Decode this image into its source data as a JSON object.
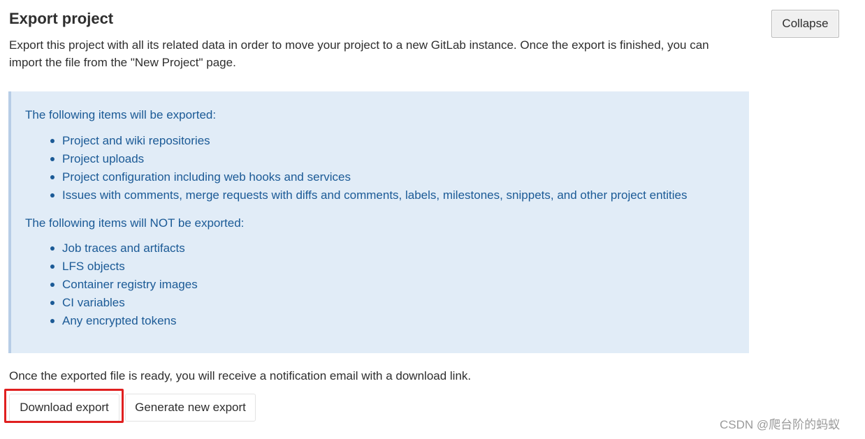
{
  "header": {
    "title": "Export project",
    "collapse_label": "Collapse"
  },
  "description": "Export this project with all its related data in order to move your project to a new GitLab instance. Once the export is finished, you can import the file from the \"New Project\" page.",
  "info_panel": {
    "included_heading": "The following items will be exported:",
    "included_items": [
      "Project and wiki repositories",
      "Project uploads",
      "Project configuration including web hooks and services",
      "Issues with comments, merge requests with diffs and comments, labels, milestones, snippets, and other project entities"
    ],
    "excluded_heading": "The following items will NOT be exported:",
    "excluded_items": [
      "Job traces and artifacts",
      "LFS objects",
      "Container registry images",
      "CI variables",
      "Any encrypted tokens"
    ]
  },
  "notice": "Once the exported file is ready, you will receive a notification email with a download link.",
  "actions": {
    "download_label": "Download export",
    "generate_label": "Generate new export"
  },
  "watermark": "CSDN @爬台阶的蚂蚁",
  "colors": {
    "panel_background": "#e1ecf7",
    "panel_text": "#1b5a96",
    "highlight": "#e02020"
  }
}
